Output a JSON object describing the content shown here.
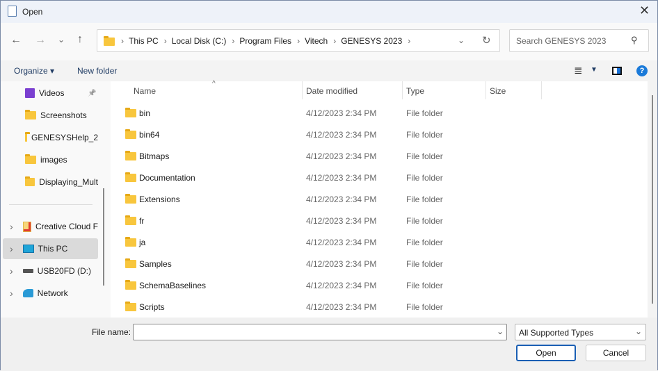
{
  "title": "Open",
  "nav": {
    "breadcrumbs": [
      "This PC",
      "Local Disk (C:)",
      "Program Files",
      "Vitech",
      "GENESYS 2023"
    ],
    "search_placeholder": "Search GENESYS 2023"
  },
  "toolbar": {
    "organize": "Organize",
    "new_folder": "New folder"
  },
  "sidebar": {
    "quick": [
      {
        "label": "Videos",
        "icon": "video-icon"
      },
      {
        "label": "Screenshots",
        "icon": "folder-icon"
      },
      {
        "label": "GENESYSHelp_2",
        "icon": "folder-icon"
      },
      {
        "label": "images",
        "icon": "folder-icon"
      },
      {
        "label": "Displaying_Mult",
        "icon": "folder-icon"
      }
    ],
    "tree": [
      {
        "label": "Creative Cloud F",
        "icon": "creative-cloud-icon"
      },
      {
        "label": "This PC",
        "icon": "monitor-icon"
      },
      {
        "label": "USB20FD (D:)",
        "icon": "drive-icon"
      },
      {
        "label": "Network",
        "icon": "network-icon"
      }
    ]
  },
  "columns": {
    "name": "Name",
    "date": "Date modified",
    "type": "Type",
    "size": "Size"
  },
  "files": [
    {
      "name": "bin",
      "date": "4/12/2023 2:34 PM",
      "type": "File folder"
    },
    {
      "name": "bin64",
      "date": "4/12/2023 2:34 PM",
      "type": "File folder"
    },
    {
      "name": "Bitmaps",
      "date": "4/12/2023 2:34 PM",
      "type": "File folder"
    },
    {
      "name": "Documentation",
      "date": "4/12/2023 2:34 PM",
      "type": "File folder"
    },
    {
      "name": "Extensions",
      "date": "4/12/2023 2:34 PM",
      "type": "File folder"
    },
    {
      "name": "fr",
      "date": "4/12/2023 2:34 PM",
      "type": "File folder"
    },
    {
      "name": "ja",
      "date": "4/12/2023 2:34 PM",
      "type": "File folder"
    },
    {
      "name": "Samples",
      "date": "4/12/2023 2:34 PM",
      "type": "File folder"
    },
    {
      "name": "SchemaBaselines",
      "date": "4/12/2023 2:34 PM",
      "type": "File folder"
    },
    {
      "name": "Scripts",
      "date": "4/12/2023 2:34 PM",
      "type": "File folder"
    }
  ],
  "bottom": {
    "file_name_label": "File name:",
    "file_name_value": "",
    "file_type": "All Supported Types",
    "open": "Open",
    "cancel": "Cancel"
  }
}
